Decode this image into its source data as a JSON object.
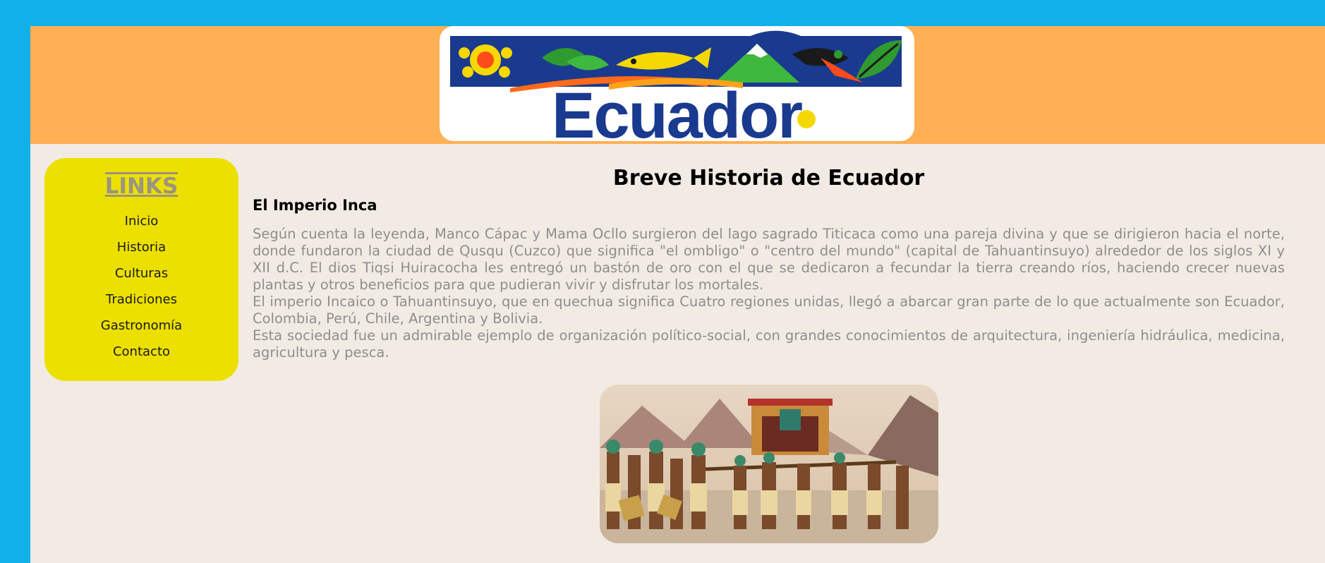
{
  "header": {
    "logo_text": "Ecuador",
    "colors": {
      "background": "#ffb055",
      "logo_text": "#1a3a8f"
    }
  },
  "sidebar": {
    "title": "LINKS",
    "items": [
      {
        "label": "Inicio"
      },
      {
        "label": "Historia"
      },
      {
        "label": "Culturas"
      },
      {
        "label": "Tradiciones"
      },
      {
        "label": "Gastronomía"
      },
      {
        "label": "Contacto"
      }
    ]
  },
  "main": {
    "title": "Breve Historia de Ecuador",
    "subtitle": "El Imperio Inca",
    "paragraphs": [
      "Según cuenta la leyenda, Manco Cápac y Mama Ocllo surgieron del lago sagrado Titicaca como una pareja divina y que se dirigieron hacia el norte, donde fundaron la ciudad de Qusqu (Cuzco) que significa \"el ombligo\" o \"centro del mundo\" (capital de Tahuantinsuyo) alrededor de los siglos XI y XII d.C. El dios Tiqsi Huiracocha les entregó un bastón de oro con el que se dedicaron a fecundar la tierra creando ríos, haciendo crecer nuevas plantas y otros beneficios para que pudieran vivir y disfrutar los mortales.",
      "El imperio Incaico o Tahuantinsuyo, que en quechua significa Cuatro regiones unidas, llegó a abarcar gran parte de lo que actualmente son Ecuador, Colombia, Perú, Chile, Argentina y Bolivia.",
      "Esta sociedad fue un admirable ejemplo de organización político-social, con grandes conocimientos de arquitectura, ingeniería hidráulica, medicina, agricultura y pesca."
    ],
    "image": {
      "subject": "inca-procession-painting"
    }
  },
  "colors": {
    "frame": "#12b0e8",
    "page_background": "#f2ebe4",
    "sidebar": "#ece000",
    "body_text": "#8e8e8e"
  }
}
